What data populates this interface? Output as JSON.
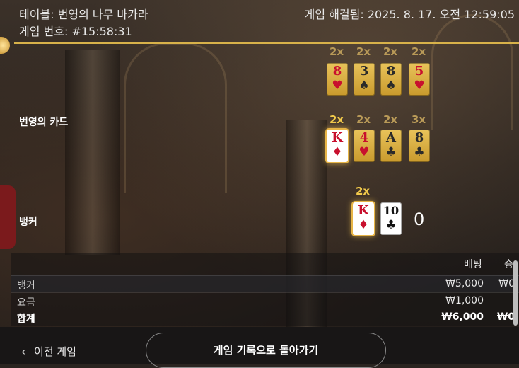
{
  "header": {
    "table_title": "테이블: 번영의 나무 바카라",
    "game_number": "게임 번호: #15:58:31",
    "resolved_at": "게임 해결됨: 2025. 8. 17. 오전 12:59:05"
  },
  "prosperity_row1": {
    "cards": [
      {
        "mult": "2x",
        "rank": "8",
        "suit": "♥",
        "color": "red"
      },
      {
        "mult": "2x",
        "rank": "3",
        "suit": "♠",
        "color": "dark"
      },
      {
        "mult": "2x",
        "rank": "8",
        "suit": "♠",
        "color": "dark"
      },
      {
        "mult": "2x",
        "rank": "5",
        "suit": "♥",
        "color": "red"
      }
    ]
  },
  "prosperity": {
    "label": "번영의 카드",
    "cards": [
      {
        "mult": "2x",
        "rank": "K",
        "suit": "♦",
        "color": "red",
        "highlighted": true
      },
      {
        "mult": "2x",
        "rank": "4",
        "suit": "♥",
        "color": "red"
      },
      {
        "mult": "2x",
        "rank": "A",
        "suit": "♣",
        "color": "dark"
      },
      {
        "mult": "3x",
        "rank": "8",
        "suit": "♣",
        "color": "dark"
      }
    ]
  },
  "banker": {
    "label": "뱅커",
    "mult": "2x",
    "cards": [
      {
        "rank": "K",
        "suit": "♦",
        "color": "red",
        "highlighted": true
      },
      {
        "rank": "10",
        "suit": "♣",
        "color": "black"
      }
    ],
    "score": "0"
  },
  "bets": {
    "col_bet": "베팅",
    "col_win": "승",
    "rows": [
      {
        "label": "뱅커",
        "bet": "₩5,000",
        "win": "₩0"
      },
      {
        "label": "요금",
        "bet": "₩1,000",
        "win": ""
      },
      {
        "label": "합계",
        "bet": "₩6,000",
        "win": "₩0"
      }
    ]
  },
  "footer": {
    "prev_label": "이전 게임",
    "back_label": "게임 기록으로 돌아가기"
  },
  "colors": {
    "gold_line": "#d8b24a",
    "card_gold": "#d4a83e",
    "suit_red": "#c8102e"
  }
}
